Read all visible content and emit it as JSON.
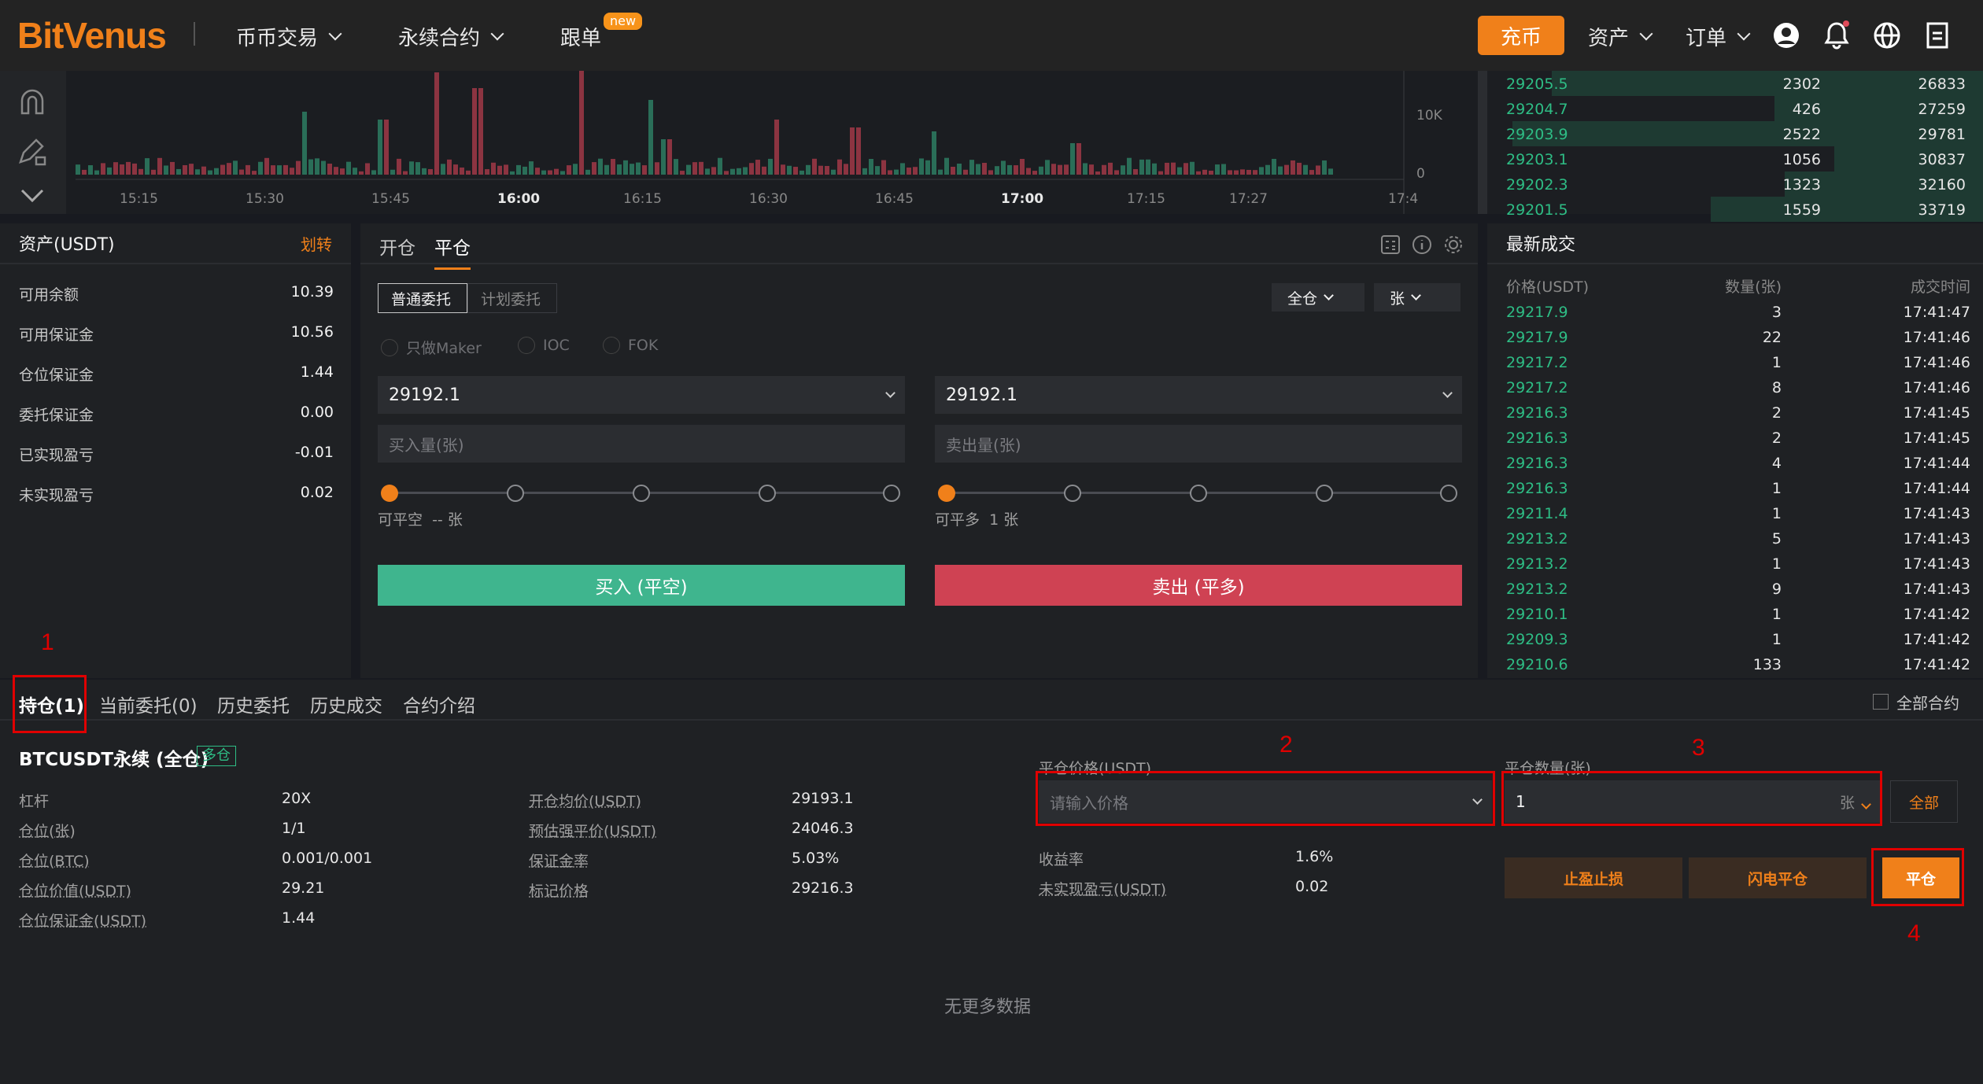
{
  "header": {
    "logo": "BitVenus",
    "nav": [
      "币币交易",
      "永续合约",
      "跟单"
    ],
    "new_badge": "new",
    "deposit": "充币",
    "assets_menu": "资产",
    "orders_menu": "订单"
  },
  "chart_axis": {
    "y_labels": [
      "10K",
      "0"
    ],
    "x_labels": [
      "15:15",
      "15:30",
      "15:45",
      "16:00",
      "16:15",
      "16:30",
      "16:45",
      "17:00",
      "17:15",
      "17:27",
      "17:4"
    ]
  },
  "orderbook": [
    {
      "price": "29205.5",
      "qty": "2302",
      "total": "26833",
      "depth": 0.87
    },
    {
      "price": "29204.7",
      "qty": "426",
      "total": "27259",
      "depth": 0.42
    },
    {
      "price": "29203.9",
      "qty": "2522",
      "total": "29781",
      "depth": 0.95
    },
    {
      "price": "29203.1",
      "qty": "1056",
      "total": "30837",
      "depth": 0.3
    },
    {
      "price": "29202.3",
      "qty": "1323",
      "total": "32160",
      "depth": 0.4
    },
    {
      "price": "29201.5",
      "qty": "1559",
      "total": "33719",
      "depth": 0.55
    }
  ],
  "assets": {
    "title": "资产(USDT)",
    "transfer": "划转",
    "rows": [
      {
        "label": "可用余额",
        "value": "10.39"
      },
      {
        "label": "可用保证金",
        "value": "10.56"
      },
      {
        "label": "仓位保证金",
        "value": "1.44"
      },
      {
        "label": "委托保证金",
        "value": "0.00"
      },
      {
        "label": "已实现盈亏",
        "value": "-0.01"
      },
      {
        "label": "未实现盈亏",
        "value": "0.02"
      }
    ]
  },
  "order": {
    "tabs": [
      "开仓",
      "平仓"
    ],
    "subtabs": [
      "普通委托",
      "计划委托"
    ],
    "margin_mode": "全仓",
    "unit": "张",
    "options": [
      "只做Maker",
      "IOC",
      "FOK"
    ],
    "buy_price": "29192.1",
    "sell_price": "29192.1",
    "buy_qty_placeholder": "买入量(张)",
    "sell_qty_placeholder": "卖出量(张)",
    "buy_avail": "可平空  -- 张",
    "sell_avail": "可平多  1 张",
    "buy_button": "买入 (平空)",
    "sell_button": "卖出 (平多)"
  },
  "trades": {
    "title": "最新成交",
    "headers": [
      "价格(USDT)",
      "数量(张)",
      "成交时间"
    ],
    "rows": [
      [
        "29217.9",
        "3",
        "17:41:47"
      ],
      [
        "29217.9",
        "22",
        "17:41:46"
      ],
      [
        "29217.2",
        "1",
        "17:41:46"
      ],
      [
        "29217.2",
        "8",
        "17:41:46"
      ],
      [
        "29216.3",
        "2",
        "17:41:45"
      ],
      [
        "29216.3",
        "2",
        "17:41:45"
      ],
      [
        "29216.3",
        "4",
        "17:41:44"
      ],
      [
        "29216.3",
        "1",
        "17:41:44"
      ],
      [
        "29211.4",
        "1",
        "17:41:43"
      ],
      [
        "29213.2",
        "5",
        "17:41:43"
      ],
      [
        "29213.2",
        "1",
        "17:41:43"
      ],
      [
        "29213.2",
        "9",
        "17:41:43"
      ],
      [
        "29210.1",
        "1",
        "17:41:42"
      ],
      [
        "29209.3",
        "1",
        "17:41:42"
      ],
      [
        "29210.6",
        "133",
        "17:41:42"
      ]
    ]
  },
  "bottom": {
    "tabs": [
      "持仓(1)",
      "当前委托(0)",
      "历史委托",
      "历史成交",
      "合约介绍"
    ],
    "all_contracts": "全部合约",
    "position_title": "BTCUSDT永续 (全仓)",
    "side_badge": "多仓",
    "left_fields": [
      {
        "label": "杠杆",
        "value": "20X"
      },
      {
        "label": "仓位(张)",
        "value": "1/1"
      },
      {
        "label": "仓位(BTC)",
        "value": "0.001/0.001"
      },
      {
        "label": "仓位价值(USDT)",
        "value": "29.21"
      },
      {
        "label": "仓位保证金(USDT)",
        "value": "1.44"
      }
    ],
    "mid_fields": [
      {
        "label": "开仓均价(USDT)",
        "value": "29193.1"
      },
      {
        "label": "预估强平价(USDT)",
        "value": "24046.3"
      },
      {
        "label": "保证金率",
        "value": "5.03%"
      },
      {
        "label": "标记价格",
        "value": "29216.3"
      }
    ],
    "close_price_label": "平仓价格(USDT)",
    "close_price_placeholder": "请输入价格",
    "close_qty_label": "平仓数量(张)",
    "close_qty_value": "1",
    "close_qty_unit": "张",
    "all_button": "全部",
    "yield_label": "收益率",
    "yield_value": "1.6%",
    "upnl_label": "未实现盈亏(USDT)",
    "upnl_value": "0.02",
    "tpsl_button": "止盈止损",
    "flash_close_button": "闪电平仓",
    "close_button": "平仓",
    "no_more": "无更多数据"
  },
  "annotations": [
    "1",
    "2",
    "3",
    "4"
  ],
  "colors": {
    "accent": "#f0801a",
    "up": "#2ebd85",
    "down": "#e04b5a",
    "annotation": "#e00000"
  }
}
